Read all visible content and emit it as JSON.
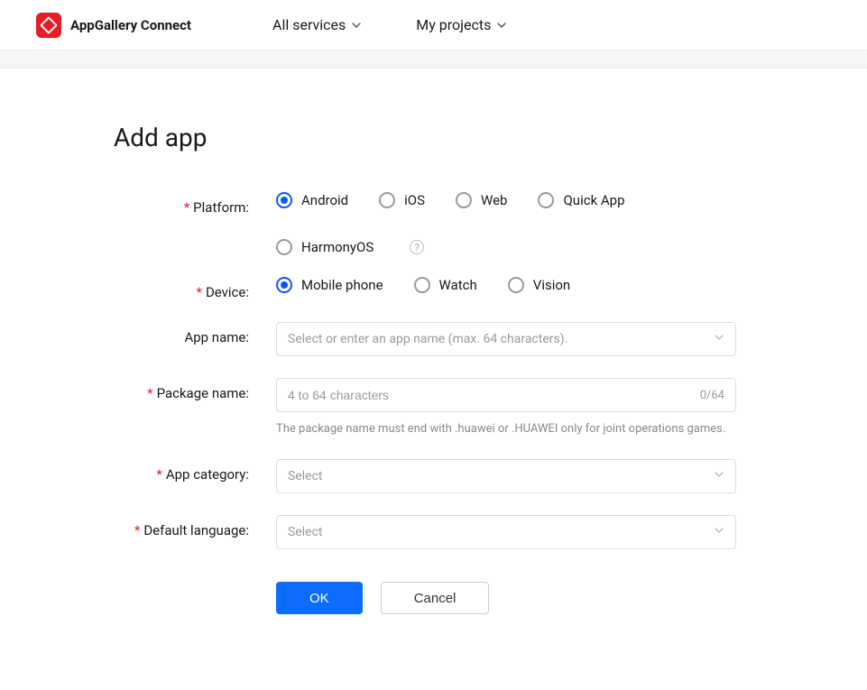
{
  "header": {
    "brand": "AppGallery Connect",
    "nav": {
      "all_services": "All services",
      "my_projects": "My projects"
    }
  },
  "page": {
    "title": "Add app"
  },
  "form": {
    "platform": {
      "label": "Platform:",
      "options": {
        "android": "Android",
        "ios": "iOS",
        "web": "Web",
        "quick_app": "Quick App",
        "harmonyos": "HarmonyOS"
      },
      "selected": "android"
    },
    "device": {
      "label": "Device:",
      "options": {
        "mobile": "Mobile phone",
        "watch": "Watch",
        "vision": "Vision"
      },
      "selected": "mobile"
    },
    "app_name": {
      "label": "App name:",
      "placeholder": "Select or enter an app name (max. 64 characters)."
    },
    "package_name": {
      "label": "Package name:",
      "placeholder": "4 to 64 characters",
      "counter": "0/64",
      "hint": "The package name must end with .huawei or .HUAWEI only for joint operations games."
    },
    "app_category": {
      "label": "App category:",
      "placeholder": "Select"
    },
    "default_language": {
      "label": "Default language:",
      "placeholder": "Select"
    },
    "buttons": {
      "ok": "OK",
      "cancel": "Cancel"
    }
  }
}
